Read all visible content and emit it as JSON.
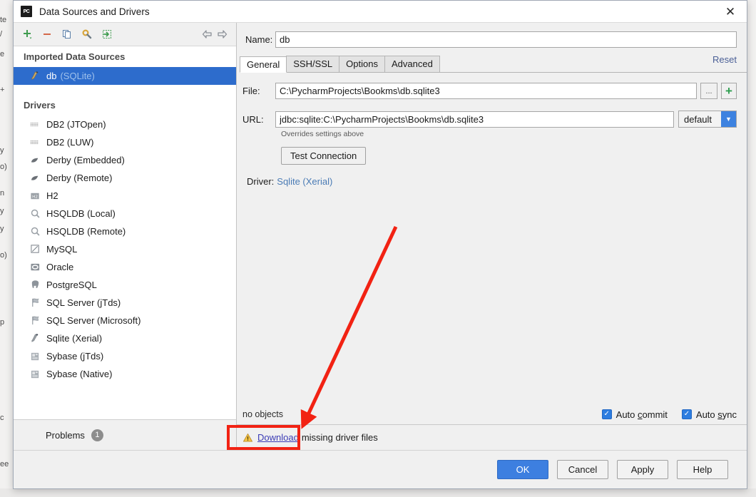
{
  "window": {
    "title": "Data Sources and Drivers",
    "app_icon": "pycharm-icon",
    "close_icon": "close-icon"
  },
  "left_panel": {
    "toolbar": [
      {
        "name": "add-button",
        "icon": "plus-icon"
      },
      {
        "name": "remove-button",
        "icon": "minus-icon"
      },
      {
        "name": "copy-button",
        "icon": "copy-icon"
      },
      {
        "name": "configure-button",
        "icon": "wrench-icon"
      },
      {
        "name": "import-button",
        "icon": "import-arrow-icon"
      }
    ],
    "nav": [
      {
        "name": "back-button",
        "icon": "arrow-left-icon"
      },
      {
        "name": "forward-button",
        "icon": "arrow-right-icon"
      }
    ],
    "imported_header": "Imported Data Sources",
    "data_sources": [
      {
        "label": "db",
        "sub": "(SQLite)",
        "icon": "sqlite-icon",
        "selected": true
      }
    ],
    "drivers_header": "Drivers",
    "drivers": [
      {
        "label": "DB2 (JTOpen)",
        "icon": "ibm-icon"
      },
      {
        "label": "DB2 (LUW)",
        "icon": "ibm-icon"
      },
      {
        "label": "Derby (Embedded)",
        "icon": "derby-leaf-icon"
      },
      {
        "label": "Derby (Remote)",
        "icon": "derby-leaf-icon"
      },
      {
        "label": "H2",
        "icon": "h2-icon"
      },
      {
        "label": "HSQLDB (Local)",
        "icon": "hsqldb-icon"
      },
      {
        "label": "HSQLDB (Remote)",
        "icon": "hsqldb-icon"
      },
      {
        "label": "MySQL",
        "icon": "mysql-icon"
      },
      {
        "label": "Oracle",
        "icon": "oracle-icon"
      },
      {
        "label": "PostgreSQL",
        "icon": "postgresql-elephant-icon"
      },
      {
        "label": "SQL Server (jTds)",
        "icon": "sqlserver-icon"
      },
      {
        "label": "SQL Server (Microsoft)",
        "icon": "sqlserver-icon"
      },
      {
        "label": "Sqlite (Xerial)",
        "icon": "sqlite-icon"
      },
      {
        "label": "Sybase (jTds)",
        "icon": "sybase-icon"
      },
      {
        "label": "Sybase (Native)",
        "icon": "sybase-icon"
      }
    ],
    "problems": {
      "label": "Problems",
      "count": "1",
      "warning_icon": "warning-triangle-icon"
    }
  },
  "right_panel": {
    "name_label": "Name:",
    "name_value": "db",
    "name_placeholder": "",
    "reset_label": "Reset",
    "tabs": [
      {
        "label": "General",
        "active": true
      },
      {
        "label": "SSH/SSL",
        "active": false
      },
      {
        "label": "Options",
        "active": false
      },
      {
        "label": "Advanced",
        "active": false
      }
    ],
    "file_label": "File:",
    "file_value": "C:\\PycharmProjects\\Bookms\\db.sqlite3",
    "browse_label": "...",
    "add_file_icon": "plus-icon",
    "url_label": "URL:",
    "url_value": "jdbc:sqlite:C:\\PycharmProjects\\Bookms\\db.sqlite3",
    "dialect_value": "default",
    "dialect_arrow_icon": "chevron-down-icon",
    "overrides_note": "Overrides settings above",
    "test_connection_label": "Test Connection",
    "driver_label": "Driver:",
    "driver_value": "Sqlite (Xerial)",
    "no_objects": "no objects",
    "checkboxes": [
      {
        "label_before": "Auto ",
        "label_accel": "c",
        "label_after": "ommit",
        "checked": true,
        "name": "auto-commit-checkbox"
      },
      {
        "label_before": "Auto ",
        "label_accel": "s",
        "label_after": "ync",
        "checked": true,
        "name": "auto-sync-checkbox"
      }
    ],
    "warning_icon": "warning-triangle-icon",
    "download_link": "Download",
    "warning_text": "missing driver files"
  },
  "footer": {
    "buttons": [
      {
        "label": "OK",
        "primary": true,
        "name": "ok-button"
      },
      {
        "label": "Cancel",
        "primary": false,
        "name": "cancel-button"
      },
      {
        "label": "Apply",
        "primary": false,
        "name": "apply-button"
      },
      {
        "label": "Help",
        "primary": false,
        "name": "help-button"
      }
    ]
  },
  "annotations": {
    "arrow_color": "#f22213",
    "rect_color": "#f22213",
    "arrow_from": "555,318",
    "arrow_to": "425,595",
    "rect": "318,597,102,33"
  },
  "colors": {
    "accent": "#2d6ccc",
    "primary_button": "#3d7fe0",
    "link": "#3b3bb5",
    "annotation_red": "#f22213"
  }
}
